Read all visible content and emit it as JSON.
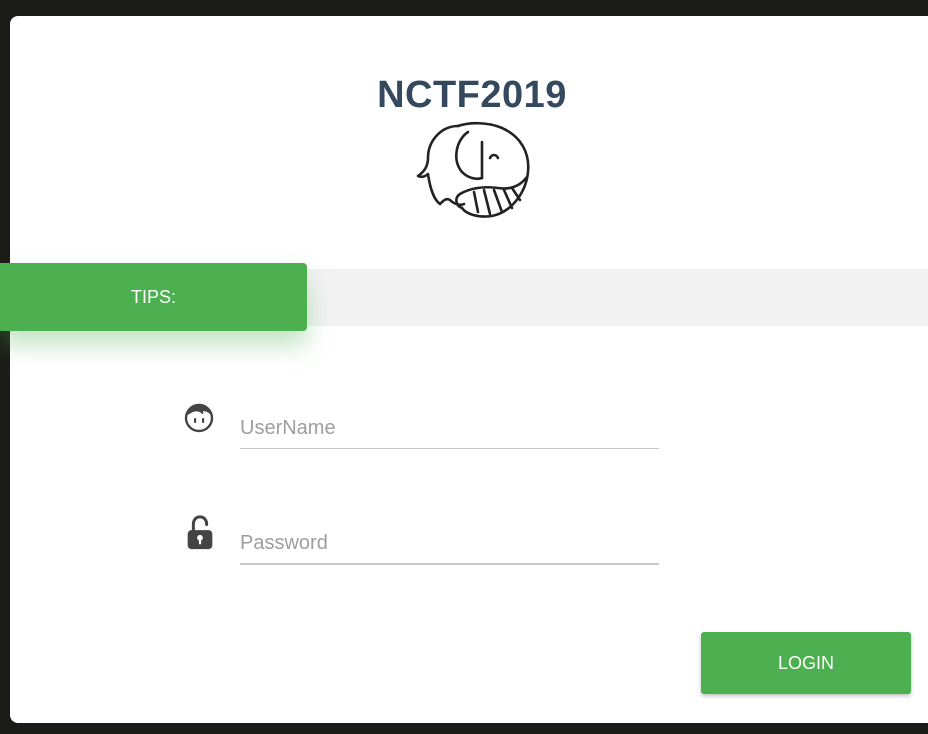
{
  "header": {
    "title": "NCTF2019",
    "logo_icon": "elephant-icon"
  },
  "tips": {
    "label": "TIPS:",
    "content": ""
  },
  "form": {
    "username": {
      "icon": "user-face-icon",
      "placeholder": "UserName",
      "value": ""
    },
    "password": {
      "icon": "unlock-icon",
      "placeholder": "Password",
      "value": ""
    },
    "login_label": "LOGIN"
  },
  "colors": {
    "accent": "#4caf50",
    "title": "#34495e",
    "tips_bar": "#f2f2f2",
    "background": "#1b1b17"
  }
}
